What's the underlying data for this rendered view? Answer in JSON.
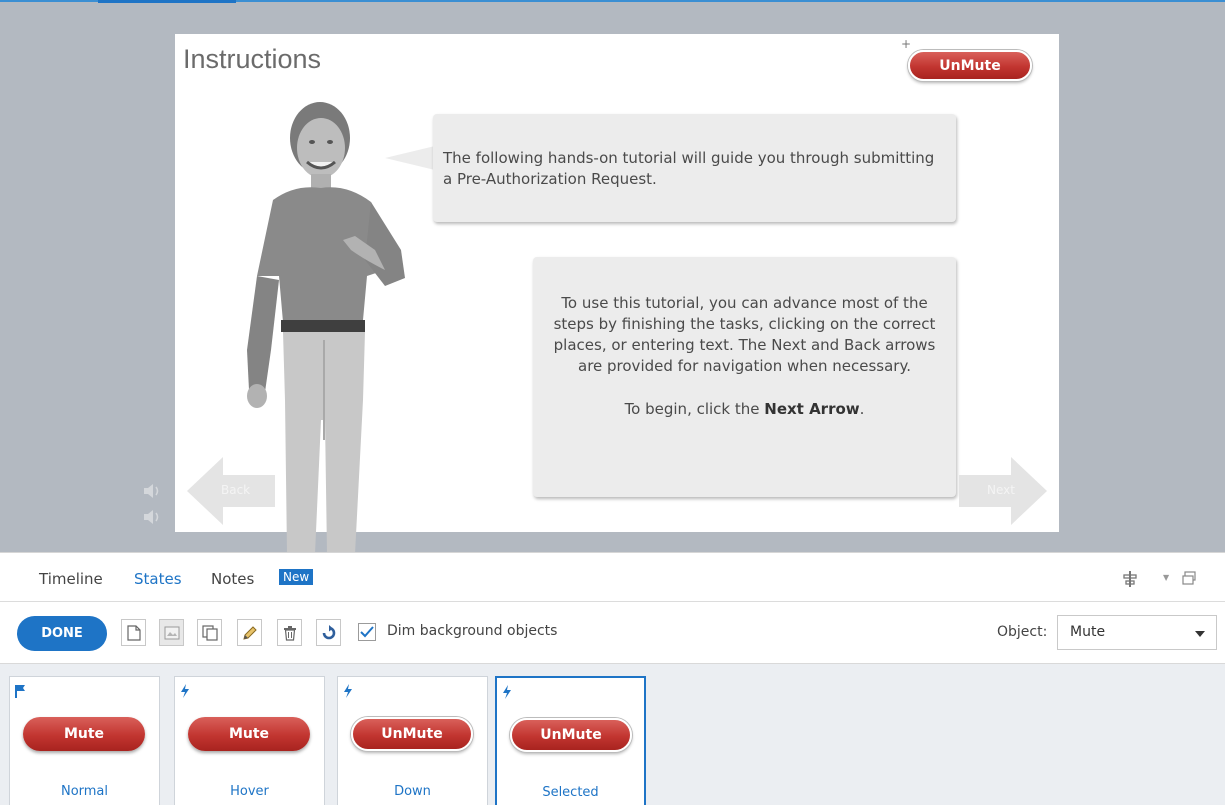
{
  "slide": {
    "title": "Instructions",
    "unmute_label": "UnMute",
    "unmute_marker": "+",
    "bubble1_text": "The following hands-on tutorial will guide you through submitting a Pre-Authorization Request.",
    "bubble2_text": "To use this tutorial, you can advance most of the steps by finishing the tasks, clicking on the correct places, or entering text. The Next and Back arrows are provided for navigation when necessary.",
    "bubble2_begin_prefix": "To begin, click the ",
    "bubble2_begin_bold": "Next Arrow",
    "bubble2_begin_suffix": ".",
    "back_label": "Back",
    "next_label": "Next"
  },
  "panel": {
    "tabs": [
      {
        "label": "Timeline"
      },
      {
        "label": "States",
        "active": true
      },
      {
        "label": "Notes"
      }
    ],
    "new_badge": "New"
  },
  "toolbar": {
    "done_label": "DONE",
    "icons": [
      "new-state-icon",
      "image-state-icon",
      "duplicate-state-icon",
      "edit-state-icon",
      "delete-state-icon",
      "reset-state-icon"
    ],
    "dim_background_label": "Dim background objects",
    "dim_background_checked": true,
    "object_label": "Object:",
    "object_value": "Mute"
  },
  "states": [
    {
      "name": "Normal",
      "button_label": "Mute",
      "icon": "flag-icon"
    },
    {
      "name": "Hover",
      "button_label": "Mute",
      "icon": "lightning-icon"
    },
    {
      "name": "Down",
      "button_label": "UnMute",
      "icon": "lightning-icon"
    },
    {
      "name": "Selected",
      "button_label": "UnMute",
      "icon": "lightning-icon",
      "selected": true
    }
  ],
  "colors": {
    "accent": "#1e74c6",
    "button_red": "#c23530",
    "stage_background": "#b3b9c1"
  }
}
